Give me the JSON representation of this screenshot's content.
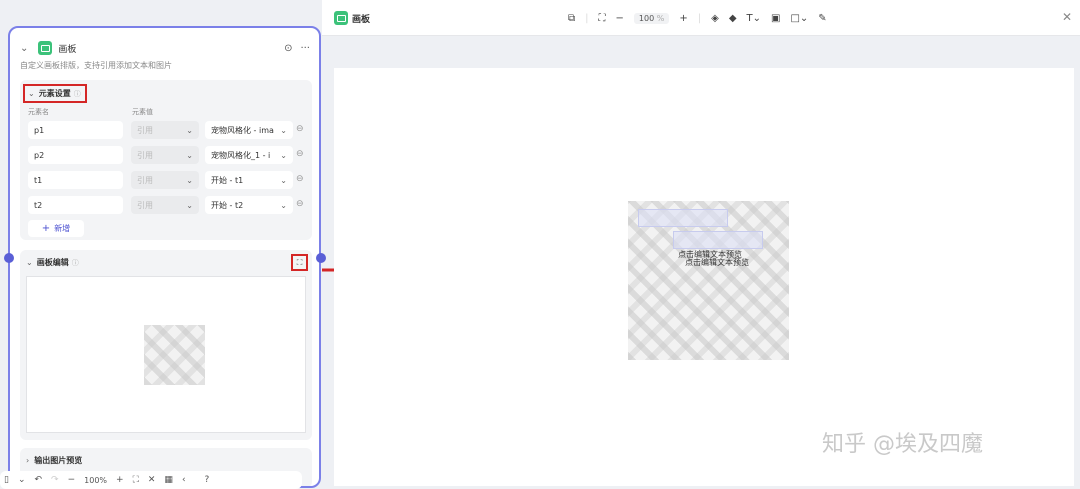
{
  "node": {
    "title": "画板",
    "description": "自定义画板排版，支持引用添加文本和图片",
    "elements_section": "元素设置",
    "col_name": "元素名",
    "col_value": "元素值",
    "rows": [
      {
        "name": "p1",
        "ref": "引用",
        "value": "宠物风格化 - ima"
      },
      {
        "name": "p2",
        "ref": "引用",
        "value": "宠物风格化_1 - i"
      },
      {
        "name": "t1",
        "ref": "引用",
        "value": "开始 - t1"
      },
      {
        "name": "t2",
        "ref": "引用",
        "value": "开始 - t2"
      }
    ],
    "add_label": "新增",
    "canvas_section": "画板编辑",
    "output_section": "输出图片预览"
  },
  "bottom_toolbar": {
    "zoom": "100%"
  },
  "editor": {
    "title": "画板",
    "zoom": "100",
    "zoom_unit": "%",
    "canvas_text_1": "点击编辑文本预览",
    "canvas_text_2": "点击编辑文本预览"
  },
  "watermark": "知乎 @埃及四魔",
  "colors": {
    "accent": "#5a5fd6",
    "highlight": "#d42626",
    "green": "#3cc27a"
  }
}
